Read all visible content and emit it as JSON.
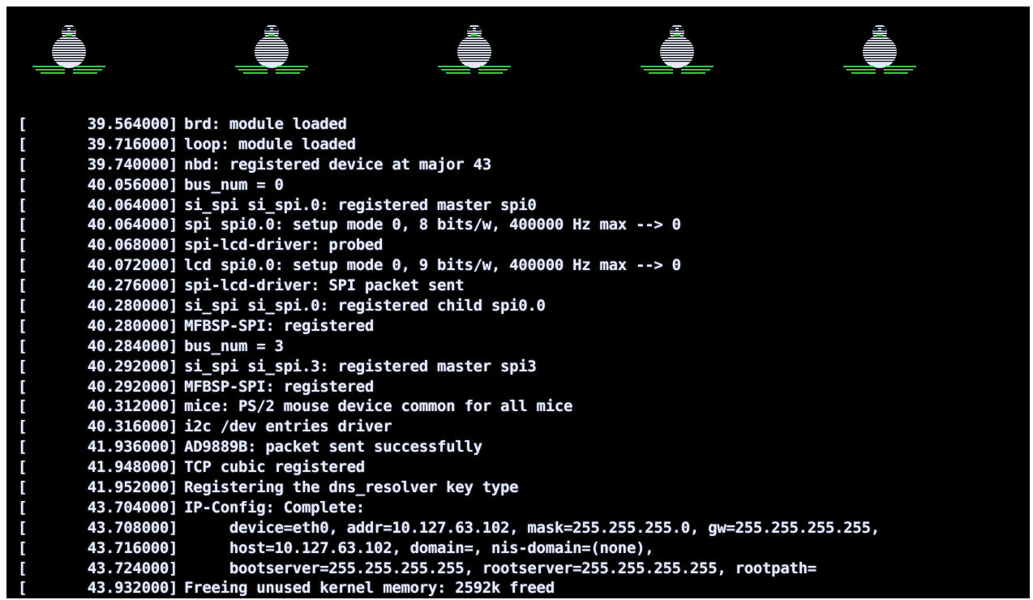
{
  "logo_icon": "tux-penguin-icon",
  "logo_count": 5,
  "colors": {
    "background": "#000000",
    "text": "#e8ecff",
    "penguin_body": "#e4ecf8",
    "penguin_feet": "#3ec24a"
  },
  "log_lines": [
    {
      "ts": "39.564000",
      "msg": "brd: module loaded"
    },
    {
      "ts": "39.716000",
      "msg": "loop: module loaded"
    },
    {
      "ts": "39.740000",
      "msg": "nbd: registered device at major 43"
    },
    {
      "ts": "40.056000",
      "msg": "bus_num = 0"
    },
    {
      "ts": "40.064000",
      "msg": "si_spi si_spi.0: registered master spi0"
    },
    {
      "ts": "40.064000",
      "msg": "spi spi0.0: setup mode 0, 8 bits/w, 400000 Hz max --> 0"
    },
    {
      "ts": "40.068000",
      "msg": "spi-lcd-driver: probed"
    },
    {
      "ts": "40.072000",
      "msg": "lcd spi0.0: setup mode 0, 9 bits/w, 400000 Hz max --> 0"
    },
    {
      "ts": "40.276000",
      "msg": "spi-lcd-driver: SPI packet sent"
    },
    {
      "ts": "40.280000",
      "msg": "si_spi si_spi.0: registered child spi0.0"
    },
    {
      "ts": "40.280000",
      "msg": "MFBSP-SPI: registered"
    },
    {
      "ts": "40.284000",
      "msg": "bus_num = 3"
    },
    {
      "ts": "40.292000",
      "msg": "si_spi si_spi.3: registered master spi3"
    },
    {
      "ts": "40.292000",
      "msg": "MFBSP-SPI: registered"
    },
    {
      "ts": "40.312000",
      "msg": "mice: PS/2 mouse device common for all mice"
    },
    {
      "ts": "40.316000",
      "msg": "i2c /dev entries driver"
    },
    {
      "ts": "41.936000",
      "msg": "AD9889B: packet sent successfully"
    },
    {
      "ts": "41.948000",
      "msg": "TCP cubic registered"
    },
    {
      "ts": "41.952000",
      "msg": "Registering the dns_resolver key type"
    },
    {
      "ts": "43.704000",
      "msg": "IP-Config: Complete:"
    },
    {
      "ts": "43.708000",
      "msg": "     device=eth0, addr=10.127.63.102, mask=255.255.255.0, gw=255.255.255.255,"
    },
    {
      "ts": "43.716000",
      "msg": "     host=10.127.63.102, domain=, nis-domain=(none),"
    },
    {
      "ts": "43.724000",
      "msg": "     bootserver=255.255.255.255, rootserver=255.255.255.255, rootpath="
    },
    {
      "ts": "43.932000",
      "msg": "Freeing unused kernel memory: 2592k freed"
    }
  ]
}
